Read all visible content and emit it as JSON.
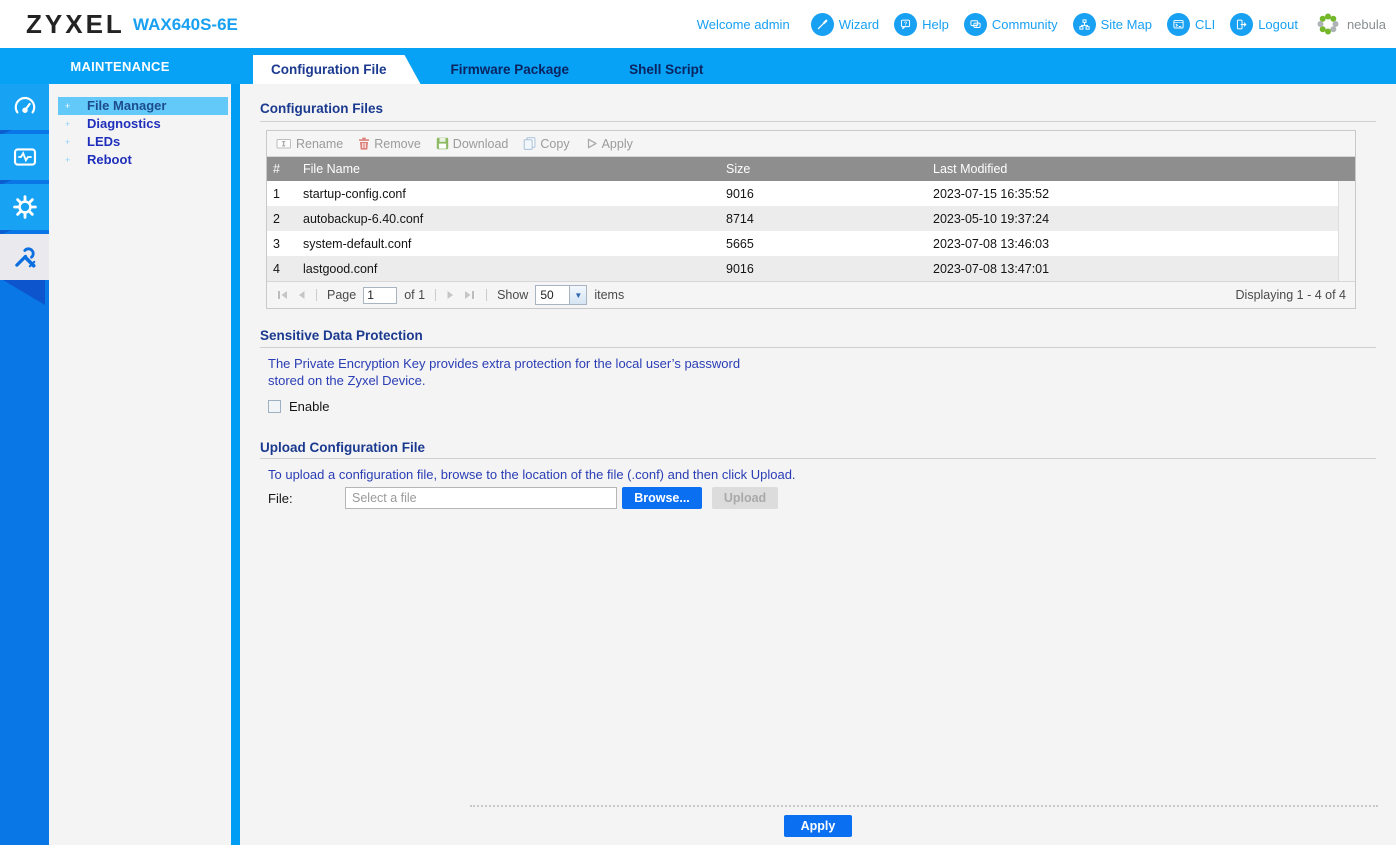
{
  "colors": {
    "brand": "#18a0f2",
    "bar": "#07a1f6",
    "rail": "#0a77e6",
    "tile": "#18a2f3",
    "divider": "#009df5",
    "select": "#63c9f8",
    "menu-text": "#1f2fbb",
    "menu-text-active": "#1d4b8f",
    "tab-text": "#0a2560",
    "heading": "#1b3a8f",
    "body-blue": "#2a3db5",
    "button": "#0b6ff2",
    "thead": "#8e8e8e",
    "row-alt": "#ececec",
    "content-bg": "#f4f4f4"
  },
  "header": {
    "logo": "ZYXEL",
    "model": "WAX640S-6E",
    "welcome": "Welcome admin",
    "links": [
      {
        "label": "Wizard"
      },
      {
        "label": "Help"
      },
      {
        "label": "Community"
      },
      {
        "label": "Site Map"
      },
      {
        "label": "CLI"
      },
      {
        "label": "Logout"
      }
    ],
    "nebula_label": "nebula"
  },
  "sidebar": {
    "title": "MAINTENANCE",
    "items": [
      {
        "label": "File Manager"
      },
      {
        "label": "Diagnostics"
      },
      {
        "label": "LEDs"
      },
      {
        "label": "Reboot"
      }
    ]
  },
  "tabs": [
    {
      "label": "Configuration File"
    },
    {
      "label": "Firmware Package"
    },
    {
      "label": "Shell Script"
    }
  ],
  "config_files": {
    "heading": "Configuration Files",
    "toolbar": [
      {
        "label": "Rename"
      },
      {
        "label": "Remove"
      },
      {
        "label": "Download"
      },
      {
        "label": "Copy"
      },
      {
        "label": "Apply"
      }
    ],
    "table": {
      "columns": [
        "#",
        "File Name",
        "Size",
        "Last Modified"
      ],
      "rows": [
        [
          "1",
          "startup-config.conf",
          "9016",
          "2023-07-15 16:35:52"
        ],
        [
          "2",
          "autobackup-6.40.conf",
          "8714",
          "2023-05-10 19:37:24"
        ],
        [
          "3",
          "system-default.conf",
          "5665",
          "2023-07-08 13:46:03"
        ],
        [
          "4",
          "lastgood.conf",
          "9016",
          "2023-07-08 13:47:01"
        ]
      ]
    },
    "pager": {
      "page_label": "Page",
      "page_value": "1",
      "of_label": "of 1",
      "show_label": "Show",
      "show_value": "50",
      "items_label": "items",
      "displaying": "Displaying 1 - 4 of 4"
    }
  },
  "sensitive": {
    "heading": "Sensitive Data Protection",
    "line1": "The Private Encryption Key provides extra protection for the local user’s password",
    "line2": "stored on the Zyxel Device.",
    "enable_label": "Enable"
  },
  "upload": {
    "heading": "Upload Configuration File",
    "description": "To upload a configuration file, browse to the location of the file (.conf) and then click Upload.",
    "file_label": "File:",
    "placeholder": "Select a file",
    "browse_label": "Browse...",
    "upload_label": "Upload"
  },
  "footer": {
    "apply_label": "Apply"
  }
}
